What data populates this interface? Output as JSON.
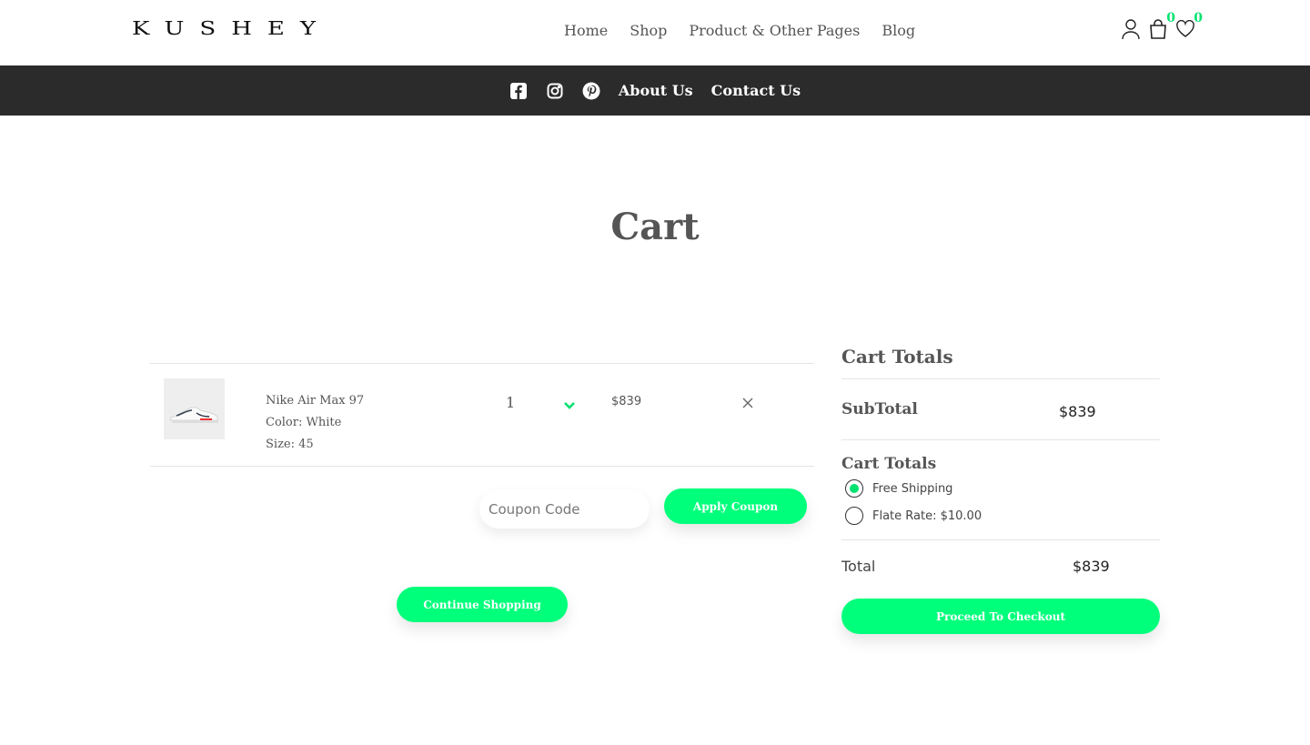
{
  "brand": {
    "logo": "KUSHEY"
  },
  "nav": {
    "items": [
      "Home",
      "Shop",
      "Product & Other Pages",
      "Blog"
    ]
  },
  "header_icons": {
    "cart_count": "0",
    "wishlist_count": "0"
  },
  "secondary_nav": {
    "about": "About Us",
    "contact": "Contact Us"
  },
  "page": {
    "title": "Cart"
  },
  "cart": {
    "items": [
      {
        "name": "Nike Air Max 97",
        "color": "Color: White",
        "size": "Size: 45",
        "qty": "1",
        "price": "$839"
      }
    ],
    "coupon_placeholder": "Coupon Code",
    "apply_label": "Apply Coupon",
    "continue_label": "Continue Shopping"
  },
  "totals": {
    "heading": "Cart Totals",
    "subtotal_label": "SubTotal",
    "subtotal_value": "$839",
    "shipping_heading": "Cart Totals",
    "options": [
      "Free Shipping",
      "Flate Rate: $10.00"
    ],
    "selected_option": 0,
    "total_label": "Total",
    "total_value": "$839",
    "checkout_label": "Proceed To Checkout"
  },
  "colors": {
    "accent": "#00ff7b",
    "dark_bar": "#2b2b2b"
  }
}
